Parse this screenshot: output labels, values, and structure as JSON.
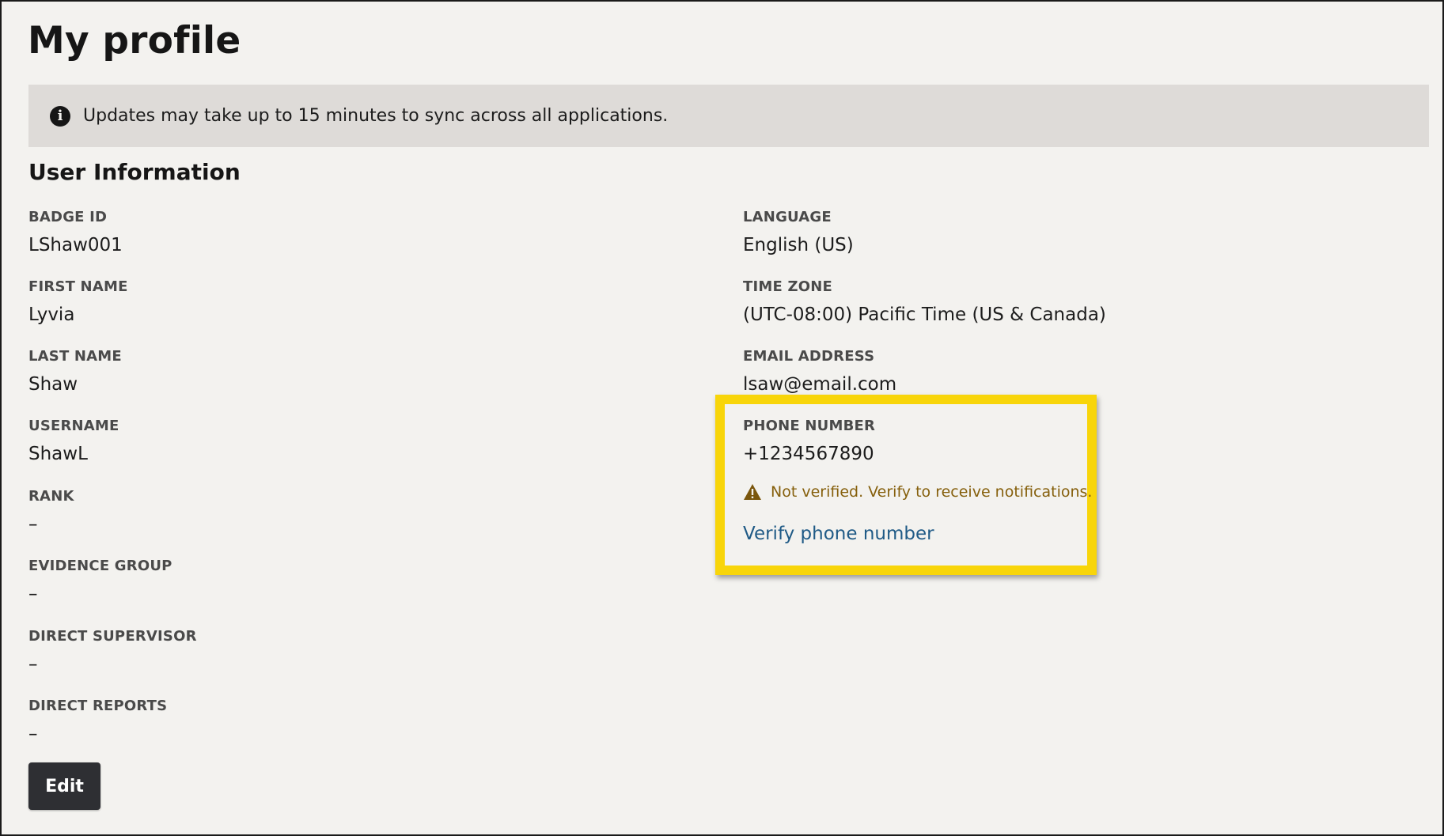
{
  "page": {
    "title": "My profile"
  },
  "banner": {
    "icon": "info-icon",
    "text": "Updates may take up to 15 minutes to sync across all applications."
  },
  "section": {
    "title": "User Information"
  },
  "left_fields": [
    {
      "label": "BADGE ID",
      "value": "LShaw001"
    },
    {
      "label": "FIRST NAME",
      "value": "Lyvia"
    },
    {
      "label": "LAST NAME",
      "value": "Shaw"
    },
    {
      "label": "USERNAME",
      "value": "ShawL"
    },
    {
      "label": "RANK",
      "value": "–"
    },
    {
      "label": "EVIDENCE GROUP",
      "value": "–"
    },
    {
      "label": "DIRECT SUPERVISOR",
      "value": "–"
    },
    {
      "label": "DIRECT REPORTS",
      "value": "–"
    }
  ],
  "right_fields": [
    {
      "label": "LANGUAGE",
      "value": "English (US)"
    },
    {
      "label": "TIME ZONE",
      "value": "(UTC-08:00) Pacific Time (US & Canada)"
    },
    {
      "label": "EMAIL ADDRESS",
      "value": "lsaw@email.com"
    },
    {
      "label": "PHONE NUMBER",
      "value": "+1234567890"
    }
  ],
  "phone_status": {
    "icon": "warning-icon",
    "warning": "Not verified. Verify to receive notifications.",
    "verify_link": "Verify phone number"
  },
  "actions": {
    "edit_label": "Edit"
  },
  "colors": {
    "highlight": "#f8d50a",
    "warning_text": "#86600d",
    "link": "#1f5a86",
    "button_bg": "#2e2f33",
    "banner_bg": "#dedbd8",
    "page_bg": "#f3f2ef"
  }
}
